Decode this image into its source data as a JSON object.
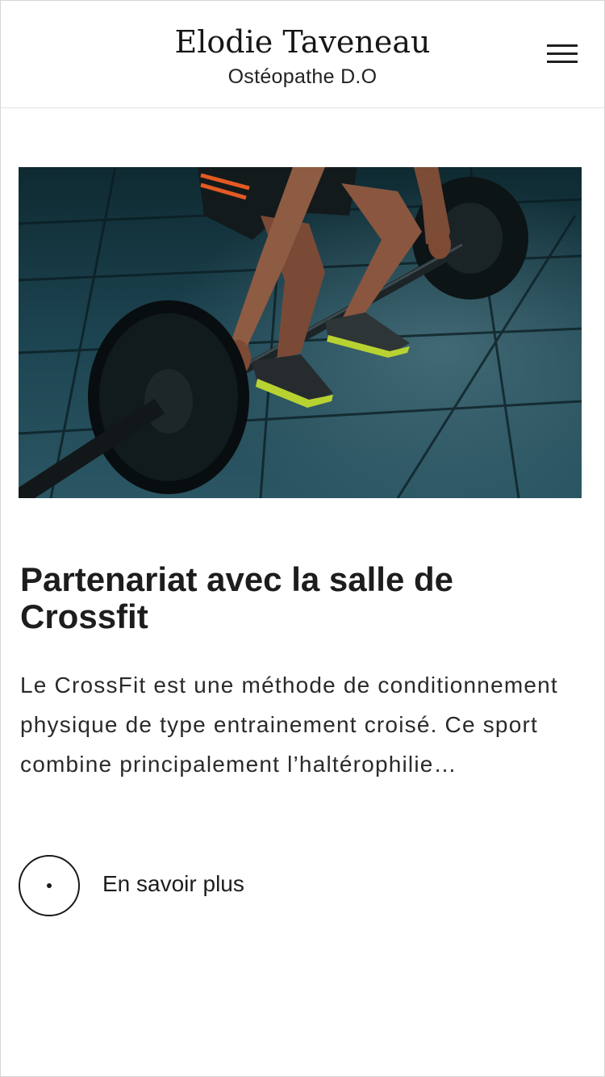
{
  "header": {
    "title": "Elodie Taveneau",
    "subtitle": "Ostéopathe D.O",
    "menu_icon": "hamburger-menu-icon"
  },
  "post": {
    "image": {
      "subject": "deadlift-barbell-photo"
    },
    "title": "Partenariat avec la salle de Crossfit",
    "excerpt": "Le CrossFit est une méthode de conditionnement physique de type entrainement croisé. Ce sport combine principalement l’haltérophilie…",
    "read_more_label": "En savoir plus"
  },
  "colors": {
    "background": "#ffffff",
    "text": "#1d1d1d",
    "border": "#e2e2e2"
  }
}
